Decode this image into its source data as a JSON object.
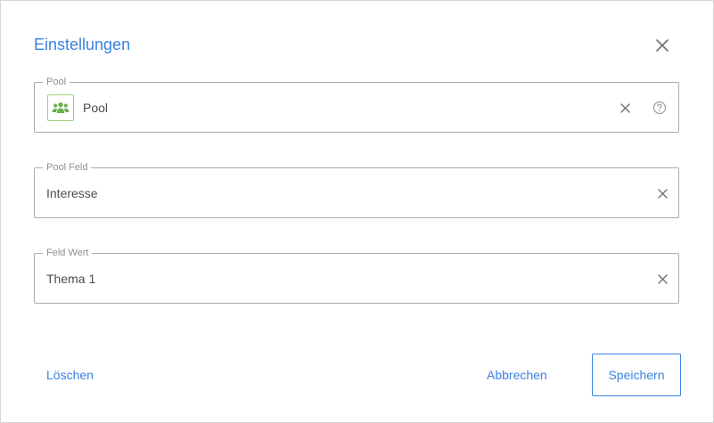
{
  "dialog": {
    "title": "Einstellungen",
    "close_icon": "close-icon"
  },
  "fields": {
    "pool": {
      "label": "Pool",
      "value": "Pool",
      "icon": "group-icon",
      "icon_color": "#6ab04c"
    },
    "pool_field": {
      "label": "Pool Feld",
      "value": "Interesse"
    },
    "field_value": {
      "label": "Feld Wert",
      "value": "Thema 1"
    }
  },
  "footer": {
    "delete_label": "Löschen",
    "cancel_label": "Abbrechen",
    "save_label": "Speichern"
  },
  "colors": {
    "accent": "#3a82e0",
    "border": "#a9adb1",
    "label": "#8c9094",
    "text": "#4a4d50"
  }
}
